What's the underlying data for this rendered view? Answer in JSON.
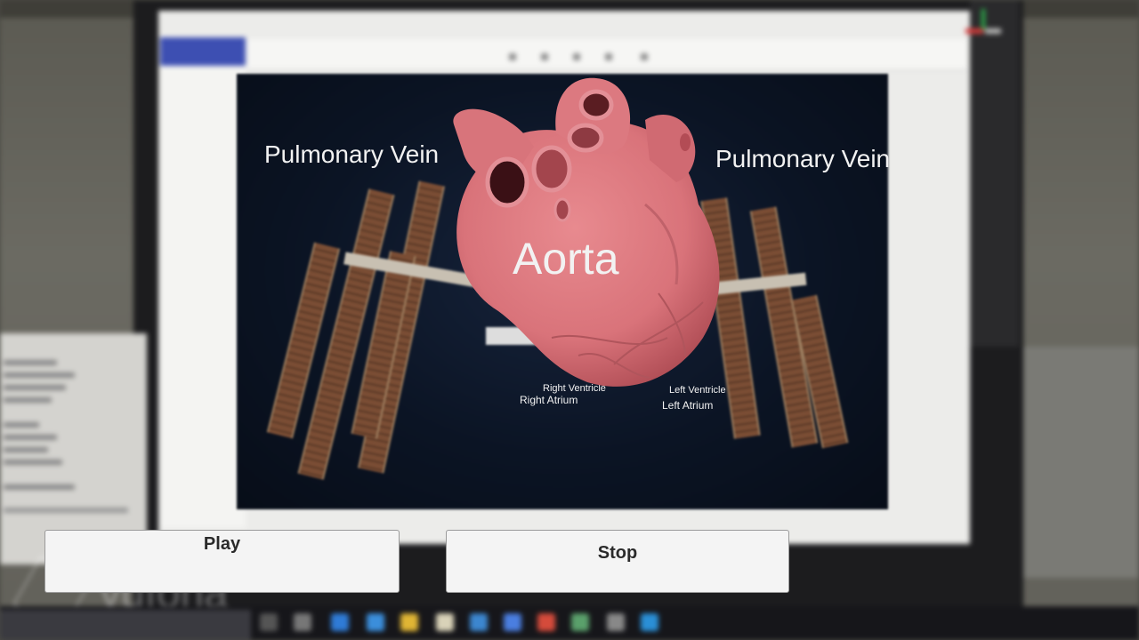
{
  "ar_labels": {
    "pulmonary_vein_left": "Pulmonary Vein",
    "pulmonary_vein_right": "Pulmonary Vein",
    "aorta": "Aorta",
    "right_ventricle": "Right Ventricle",
    "right_atrium": "Right Atrium",
    "left_ventricle": "Left Ventricle",
    "left_atrium": "Left Atrium"
  },
  "controls": {
    "play_label": "Play",
    "stop_label": "Stop"
  },
  "colors": {
    "heart": "#d9737a",
    "button_bg": "#f4f4f4",
    "label_text": "#f2f2f2"
  }
}
